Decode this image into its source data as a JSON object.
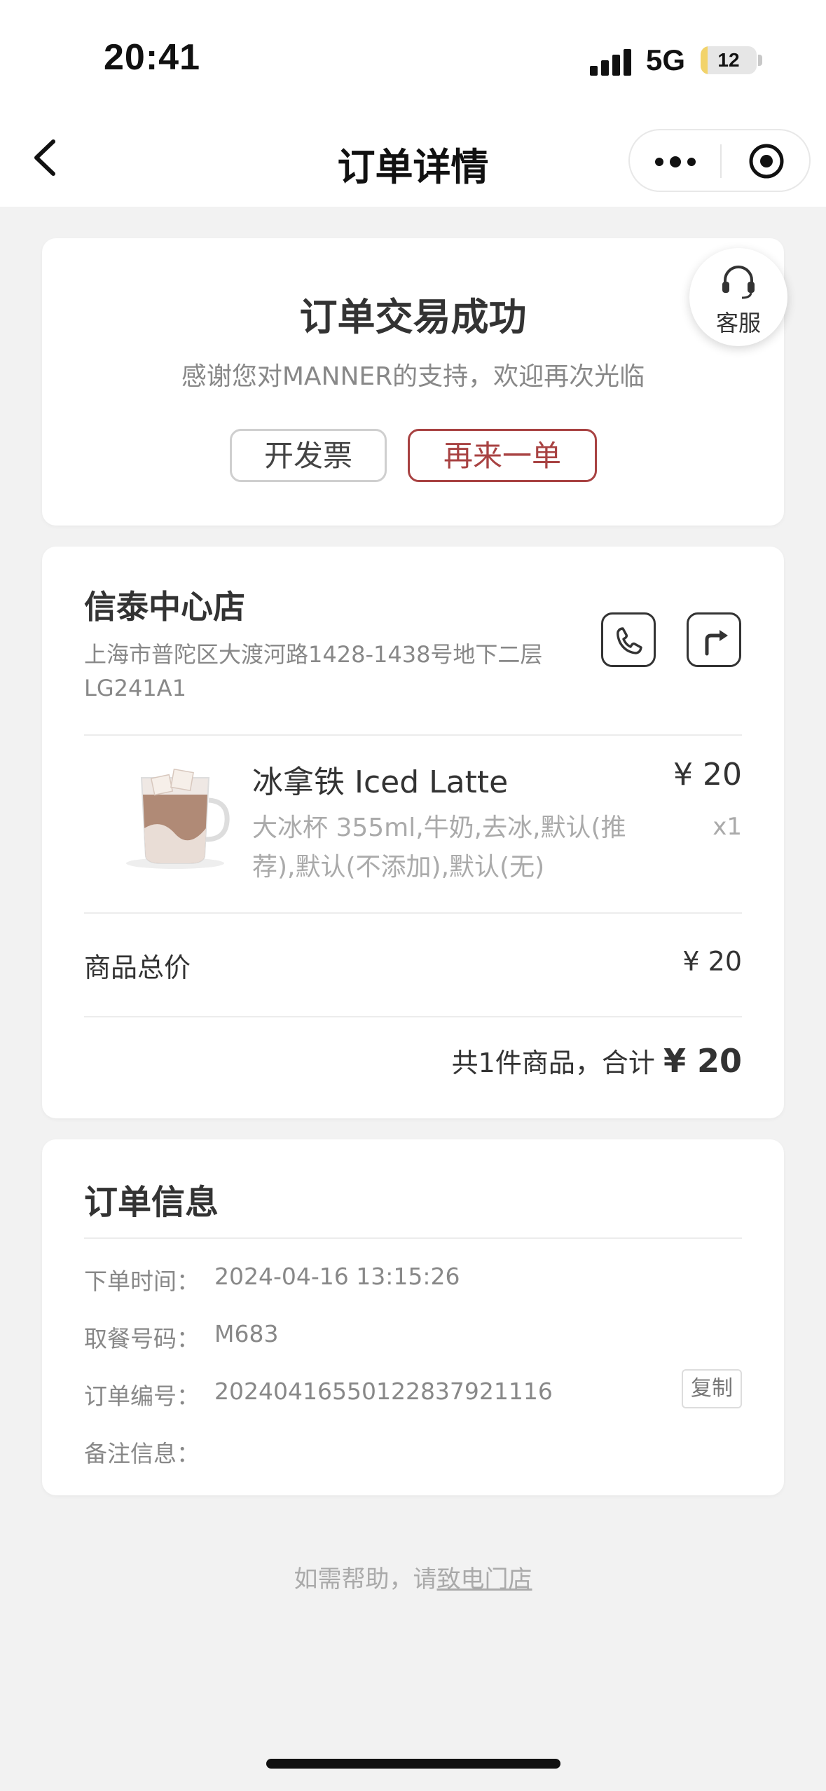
{
  "status_bar": {
    "time": "20:41",
    "network": "5G",
    "battery_level": 12,
    "battery_text": "12"
  },
  "nav": {
    "title": "订单详情",
    "icons": {
      "back": "chevron-left-icon",
      "more": "more-dots-icon",
      "close": "target-close-icon"
    }
  },
  "success": {
    "title": "订单交易成功",
    "subtitle": "感谢您对MANNER的支持，欢迎再次光临",
    "invoice_button": "开发票",
    "reorder_button": "再来一单"
  },
  "customer_service": {
    "label": "客服",
    "icon": "headset-icon"
  },
  "store": {
    "name": "信泰中心店",
    "address": "上海市普陀区大渡河路1428-1438号地下二层LG241A1",
    "icons": {
      "phone": "phone-icon",
      "route": "route-icon"
    }
  },
  "product": {
    "name": "冰拿铁 Iced Latte",
    "price": "¥ 20",
    "spec": "大冰杯 355ml,牛奶,去冰,默认(推荐),默认(不添加),默认(无)",
    "qty": "x1"
  },
  "price_summary": {
    "subtotal_label": "商品总价",
    "subtotal_value": "¥ 20",
    "total_prefix": "共1件商品，合计",
    "total_value": "¥ 20"
  },
  "order_info": {
    "title": "订单信息",
    "rows": [
      {
        "label": "下单时间：",
        "value": "2024-04-16 13:15:26"
      },
      {
        "label": "取餐号码：",
        "value": "M683"
      },
      {
        "label": "订单编号：",
        "value": "20240416550122837921116"
      },
      {
        "label": "备注信息：",
        "value": ""
      }
    ],
    "copy_button": "复制"
  },
  "help": {
    "prefix": "如需帮助，请",
    "link": "致电门店"
  },
  "colors": {
    "accent": "#a84242",
    "background": "#f2f2f2",
    "card": "#ffffff"
  }
}
